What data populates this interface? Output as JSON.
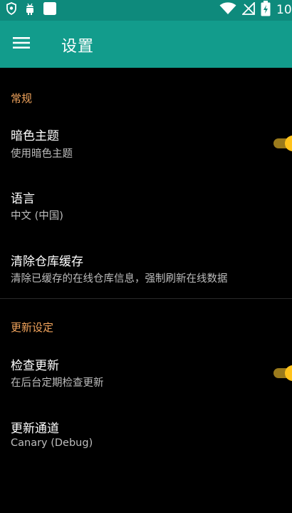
{
  "status_bar": {
    "time": "10",
    "icons": [
      "shield-icon",
      "android-icon",
      "notification-square-icon",
      "wifi-icon",
      "no-signal-icon",
      "battery-charging-icon"
    ]
  },
  "toolbar": {
    "title": "设置",
    "menu_icon": "hamburger-menu-icon",
    "background_color": "#129c8c"
  },
  "sections": [
    {
      "header": "常规",
      "items": [
        {
          "title": "暗色主题",
          "summary": "使用暗色主题",
          "switch": true
        },
        {
          "title": "语言",
          "summary": "中文 (中国)"
        },
        {
          "title": "清除仓库缓存",
          "summary": "清除已缓存的在线仓库信息，强制刷新在线数据"
        }
      ]
    },
    {
      "header": "更新设定",
      "items": [
        {
          "title": "检查更新",
          "summary": "在后台定期检查更新",
          "switch": true
        },
        {
          "title": "更新通道",
          "summary": "Canary (Debug)"
        }
      ]
    }
  ],
  "colors": {
    "accent": "#f0a35c",
    "switch_thumb": "#ffc21a",
    "background": "#000000"
  }
}
